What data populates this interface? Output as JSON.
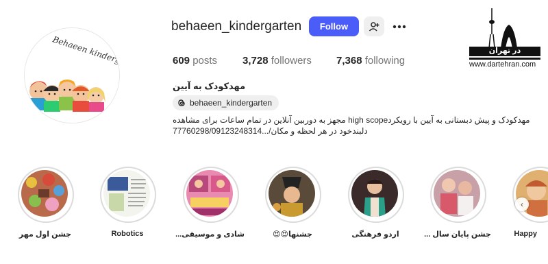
{
  "profile": {
    "username": "behaeen_kindergarten",
    "follow_label": "Follow",
    "posts_count": "609",
    "posts_label": "posts",
    "followers_count": "3,728",
    "followers_label": "followers",
    "following_count": "7,368",
    "following_label": "following",
    "full_name": "مهدکودک به آیین",
    "threads_handle": "behaeen_kindergarten",
    "bio_line1": "مهدکودک و پیش دبستانی به آیین با رویکردhigh scope مجهز به دوربین آنلاین در تمام ساعات برای مشاهده",
    "bio_line2": "دلبندخود در هر لحظه و مکان/...77760298/09123248314",
    "avatar_logo_text": "Behaeen kindergarten"
  },
  "icons": {
    "add_user": "add-user-icon",
    "more": "more-options-icon",
    "threads": "threads-icon"
  },
  "colors": {
    "follow_button": "#4a5df9",
    "secondary_button": "#efefef",
    "highlight_ring": "#dbdbdb"
  },
  "highlights": [
    {
      "label": "جشن اول مهر"
    },
    {
      "label": "Robotics"
    },
    {
      "label": "شادی و موسیقی..."
    },
    {
      "label": "جشنها😍😍"
    },
    {
      "label": "اردو فرهنگی"
    },
    {
      "label": "جشن پایان سال ..."
    },
    {
      "label": "Happy"
    }
  ],
  "watermark": {
    "logo_text": "در تهران",
    "url": "www.dartehran.com"
  }
}
